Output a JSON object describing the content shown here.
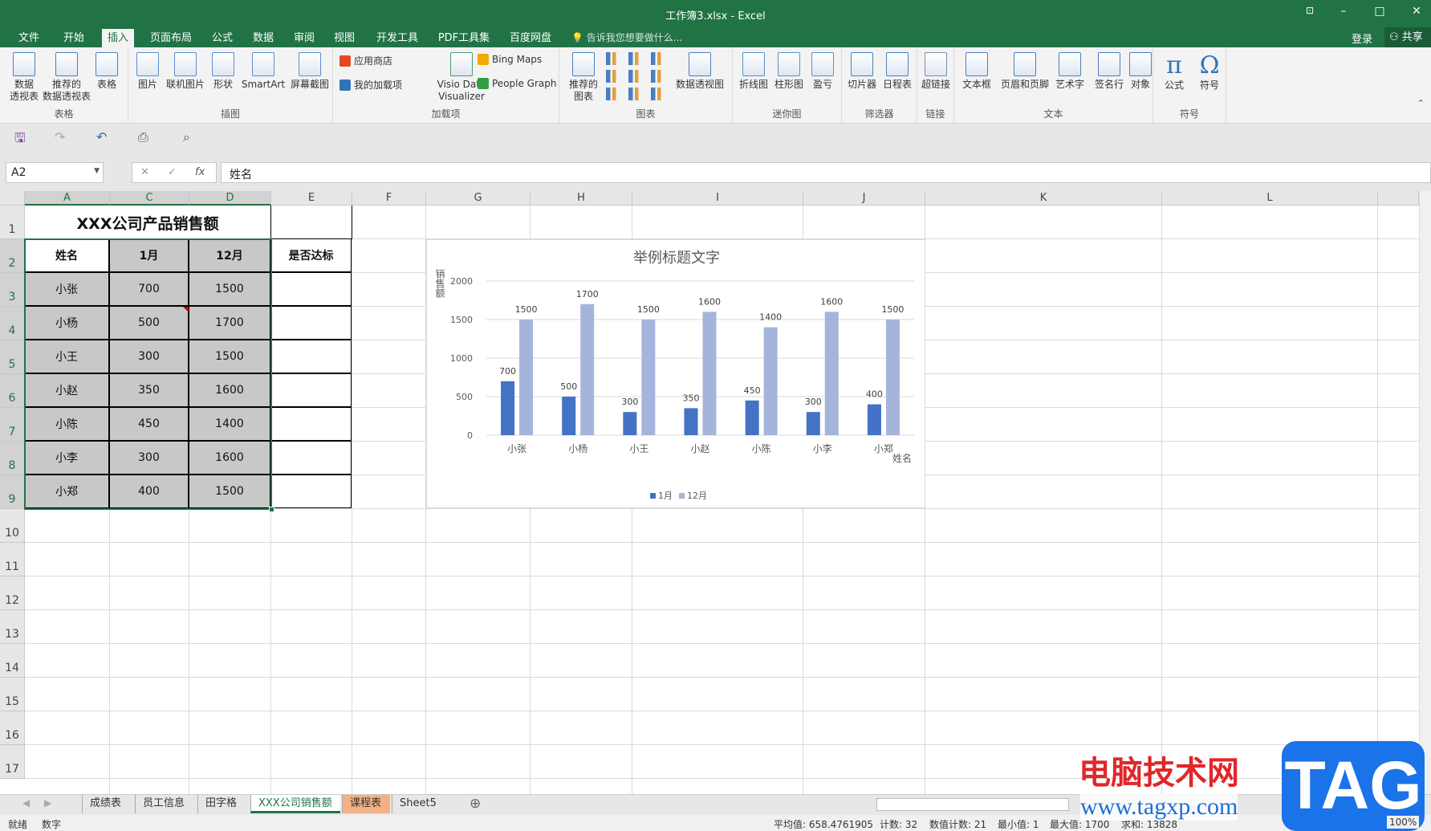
{
  "window": {
    "title": "工作簿3.xlsx - Excel",
    "restore_icon": "ribbon-display-icon",
    "min": "–",
    "max": "□",
    "close": "✕"
  },
  "tabs": [
    "文件",
    "开始",
    "插入",
    "页面布局",
    "公式",
    "数据",
    "审阅",
    "视图",
    "开发工具",
    "PDF工具集",
    "百度网盘"
  ],
  "active_tab": "插入",
  "tell_me": "告诉我您想要做什么...",
  "login": "登录",
  "share": "共享",
  "ribbon": {
    "groups": [
      {
        "label": "表格",
        "buttons": [
          "数据\n透视表",
          "推荐的\n数据透视表",
          "表格"
        ]
      },
      {
        "label": "插图",
        "buttons": [
          "图片",
          "联机图片",
          "形状",
          "SmartArt",
          "屏幕截图"
        ]
      },
      {
        "label": "加载项",
        "small": [
          "应用商店",
          "我的加载项",
          "Bing Maps",
          "People Graph"
        ],
        "buttons": [
          "Visio Data\nVisualizer"
        ]
      },
      {
        "label": "图表",
        "buttons": [
          "推荐的\n图表",
          "数据透视图"
        ]
      },
      {
        "label": "迷你图",
        "buttons": [
          "折线图",
          "柱形图",
          "盈亏"
        ]
      },
      {
        "label": "筛选器",
        "buttons": [
          "切片器",
          "日程表"
        ]
      },
      {
        "label": "链接",
        "buttons": [
          "超链接"
        ]
      },
      {
        "label": "文本",
        "buttons": [
          "文本框",
          "页眉和页脚",
          "艺术字",
          "签名行",
          "对象"
        ]
      },
      {
        "label": "符号",
        "buttons": [
          "公式",
          "符号"
        ],
        "glyphs": [
          "π",
          "Ω"
        ]
      }
    ]
  },
  "formula_bar": {
    "name_box": "A2",
    "cancel": "✕",
    "enter": "✓",
    "fx": "fx",
    "value": "姓名"
  },
  "columns": [
    "A",
    "C",
    "D",
    "E",
    "F",
    "G",
    "H",
    "I",
    "J",
    "K",
    "L"
  ],
  "selected_columns": [
    "A",
    "C",
    "D"
  ],
  "rows": [
    "1",
    "2",
    "3",
    "4",
    "5",
    "6",
    "7",
    "8",
    "9",
    "10",
    "11",
    "12",
    "13",
    "14",
    "15",
    "16",
    "17"
  ],
  "table": {
    "title": "XXX公司产品销售额",
    "headers": [
      "姓名",
      "1月",
      "12月",
      "是否达标"
    ],
    "rows": [
      [
        "小张",
        "700",
        "1500",
        ""
      ],
      [
        "小杨",
        "500",
        "1700",
        ""
      ],
      [
        "小王",
        "300",
        "1500",
        ""
      ],
      [
        "小赵",
        "350",
        "1600",
        ""
      ],
      [
        "小陈",
        "450",
        "1400",
        ""
      ],
      [
        "小李",
        "300",
        "1600",
        ""
      ],
      [
        "小郑",
        "400",
        "1500",
        ""
      ]
    ],
    "fill": "#c8c8c8",
    "selection_color": "#217346"
  },
  "chart_data": {
    "type": "bar",
    "title": "举例标题文字",
    "xlabel": "姓名",
    "ylabel": "销售额",
    "categories": [
      "小张",
      "小杨",
      "小王",
      "小赵",
      "小陈",
      "小李",
      "小郑"
    ],
    "series": [
      {
        "name": "1月",
        "values": [
          700,
          500,
          300,
          350,
          450,
          300,
          400
        ],
        "color": "#4472c4"
      },
      {
        "name": "12月",
        "values": [
          1500,
          1700,
          1500,
          1600,
          1400,
          1600,
          1500
        ],
        "color": "#a5b4da"
      }
    ],
    "ylim": [
      0,
      2000
    ],
    "yticks": [
      "0",
      "500",
      "1000",
      "1500",
      "2000"
    ],
    "grid": true,
    "legend": "bottom",
    "data_labels": true
  },
  "sheets": [
    "成绩表",
    "员工信息",
    "田字格",
    "XXX公司销售额",
    "课程表",
    "Sheet5"
  ],
  "active_sheet": "XXX公司销售额",
  "status": {
    "ready": "就绪",
    "mode": "数字",
    "average": "平均值: 658.4761905",
    "count": "计数: 32",
    "num_count": "数值计数: 21",
    "min": "最小值: 1",
    "max": "最大值: 1700",
    "sum": "求和: 13828",
    "zoom": "100%"
  },
  "watermark": {
    "cn": "电脑技术网",
    "url": "www.tagxp.com",
    "logo": "TAG"
  }
}
